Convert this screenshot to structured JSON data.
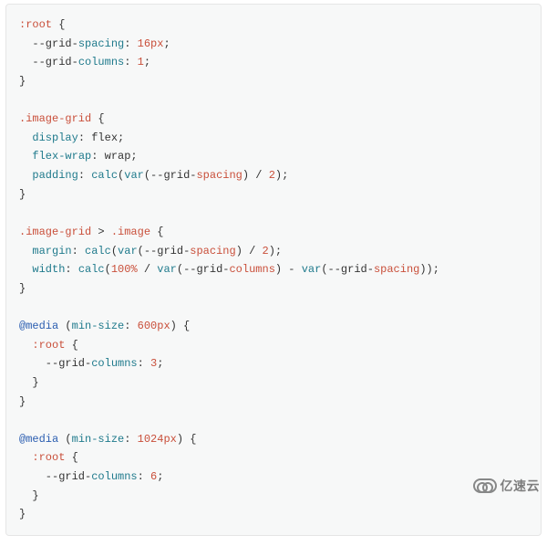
{
  "code": {
    "lines": [
      {
        "frags": [
          {
            "t": ":root",
            "c": "sel"
          },
          {
            "t": " {",
            "c": "txt"
          }
        ]
      },
      {
        "frags": [
          {
            "t": "  --grid-",
            "c": "txt"
          },
          {
            "t": "spacing",
            "c": "prop"
          },
          {
            "t": ": ",
            "c": "txt"
          },
          {
            "t": "16px",
            "c": "val"
          },
          {
            "t": ";",
            "c": "txt"
          }
        ]
      },
      {
        "frags": [
          {
            "t": "  --grid-",
            "c": "txt"
          },
          {
            "t": "columns",
            "c": "prop"
          },
          {
            "t": ": ",
            "c": "txt"
          },
          {
            "t": "1",
            "c": "val"
          },
          {
            "t": ";",
            "c": "txt"
          }
        ]
      },
      {
        "frags": [
          {
            "t": "}",
            "c": "txt"
          }
        ]
      },
      {
        "frags": [
          {
            "t": "",
            "c": "txt"
          }
        ]
      },
      {
        "frags": [
          {
            "t": ".image-grid",
            "c": "sel"
          },
          {
            "t": " {",
            "c": "txt"
          }
        ]
      },
      {
        "frags": [
          {
            "t": "  ",
            "c": "txt"
          },
          {
            "t": "display",
            "c": "prop"
          },
          {
            "t": ": flex;",
            "c": "txt"
          }
        ]
      },
      {
        "frags": [
          {
            "t": "  ",
            "c": "txt"
          },
          {
            "t": "flex-wrap",
            "c": "prop"
          },
          {
            "t": ": wrap;",
            "c": "txt"
          }
        ]
      },
      {
        "frags": [
          {
            "t": "  ",
            "c": "txt"
          },
          {
            "t": "padding",
            "c": "prop"
          },
          {
            "t": ": ",
            "c": "txt"
          },
          {
            "t": "calc",
            "c": "fn"
          },
          {
            "t": "(",
            "c": "txt"
          },
          {
            "t": "var",
            "c": "fn"
          },
          {
            "t": "(--grid-",
            "c": "txt"
          },
          {
            "t": "spacing",
            "c": "imp"
          },
          {
            "t": ") / ",
            "c": "txt"
          },
          {
            "t": "2",
            "c": "val"
          },
          {
            "t": ");",
            "c": "txt"
          }
        ]
      },
      {
        "frags": [
          {
            "t": "}",
            "c": "txt"
          }
        ]
      },
      {
        "frags": [
          {
            "t": "",
            "c": "txt"
          }
        ]
      },
      {
        "frags": [
          {
            "t": ".image-grid",
            "c": "sel"
          },
          {
            "t": " > ",
            "c": "txt"
          },
          {
            "t": ".image",
            "c": "sel"
          },
          {
            "t": " {",
            "c": "txt"
          }
        ]
      },
      {
        "frags": [
          {
            "t": "  ",
            "c": "txt"
          },
          {
            "t": "margin",
            "c": "prop"
          },
          {
            "t": ": ",
            "c": "txt"
          },
          {
            "t": "calc",
            "c": "fn"
          },
          {
            "t": "(",
            "c": "txt"
          },
          {
            "t": "var",
            "c": "fn"
          },
          {
            "t": "(--grid-",
            "c": "txt"
          },
          {
            "t": "spacing",
            "c": "imp"
          },
          {
            "t": ") / ",
            "c": "txt"
          },
          {
            "t": "2",
            "c": "val"
          },
          {
            "t": ");",
            "c": "txt"
          }
        ]
      },
      {
        "frags": [
          {
            "t": "  ",
            "c": "txt"
          },
          {
            "t": "width",
            "c": "prop"
          },
          {
            "t": ": ",
            "c": "txt"
          },
          {
            "t": "calc",
            "c": "fn"
          },
          {
            "t": "(",
            "c": "txt"
          },
          {
            "t": "100%",
            "c": "val"
          },
          {
            "t": " / ",
            "c": "txt"
          },
          {
            "t": "var",
            "c": "fn"
          },
          {
            "t": "(--grid-",
            "c": "txt"
          },
          {
            "t": "columns",
            "c": "imp"
          },
          {
            "t": ") - ",
            "c": "txt"
          },
          {
            "t": "var",
            "c": "fn"
          },
          {
            "t": "(--grid-",
            "c": "txt"
          },
          {
            "t": "spacing",
            "c": "imp"
          },
          {
            "t": "));",
            "c": "txt"
          }
        ]
      },
      {
        "frags": [
          {
            "t": "}",
            "c": "txt"
          }
        ]
      },
      {
        "frags": [
          {
            "t": "",
            "c": "txt"
          }
        ]
      },
      {
        "frags": [
          {
            "t": "@media",
            "c": "kw"
          },
          {
            "t": " (",
            "c": "txt"
          },
          {
            "t": "min-size",
            "c": "prop"
          },
          {
            "t": ": ",
            "c": "txt"
          },
          {
            "t": "600px",
            "c": "val"
          },
          {
            "t": ") {",
            "c": "txt"
          }
        ]
      },
      {
        "frags": [
          {
            "t": "  ",
            "c": "txt"
          },
          {
            "t": ":root",
            "c": "sel"
          },
          {
            "t": " {",
            "c": "txt"
          }
        ]
      },
      {
        "frags": [
          {
            "t": "    --grid-",
            "c": "txt"
          },
          {
            "t": "columns",
            "c": "prop"
          },
          {
            "t": ": ",
            "c": "txt"
          },
          {
            "t": "3",
            "c": "val"
          },
          {
            "t": ";",
            "c": "txt"
          }
        ]
      },
      {
        "frags": [
          {
            "t": "  }",
            "c": "txt"
          }
        ]
      },
      {
        "frags": [
          {
            "t": "}",
            "c": "txt"
          }
        ]
      },
      {
        "frags": [
          {
            "t": "",
            "c": "txt"
          }
        ]
      },
      {
        "frags": [
          {
            "t": "@media",
            "c": "kw"
          },
          {
            "t": " (",
            "c": "txt"
          },
          {
            "t": "min-size",
            "c": "prop"
          },
          {
            "t": ": ",
            "c": "txt"
          },
          {
            "t": "1024px",
            "c": "val"
          },
          {
            "t": ") {",
            "c": "txt"
          }
        ]
      },
      {
        "frags": [
          {
            "t": "  ",
            "c": "txt"
          },
          {
            "t": ":root",
            "c": "sel"
          },
          {
            "t": " {",
            "c": "txt"
          }
        ]
      },
      {
        "frags": [
          {
            "t": "    --grid-",
            "c": "txt"
          },
          {
            "t": "columns",
            "c": "prop"
          },
          {
            "t": ": ",
            "c": "txt"
          },
          {
            "t": "6",
            "c": "val"
          },
          {
            "t": ";",
            "c": "txt"
          }
        ]
      },
      {
        "frags": [
          {
            "t": "  }",
            "c": "txt"
          }
        ]
      },
      {
        "frags": [
          {
            "t": "}",
            "c": "txt"
          }
        ]
      }
    ]
  },
  "watermark": {
    "brand": "亿速云"
  }
}
